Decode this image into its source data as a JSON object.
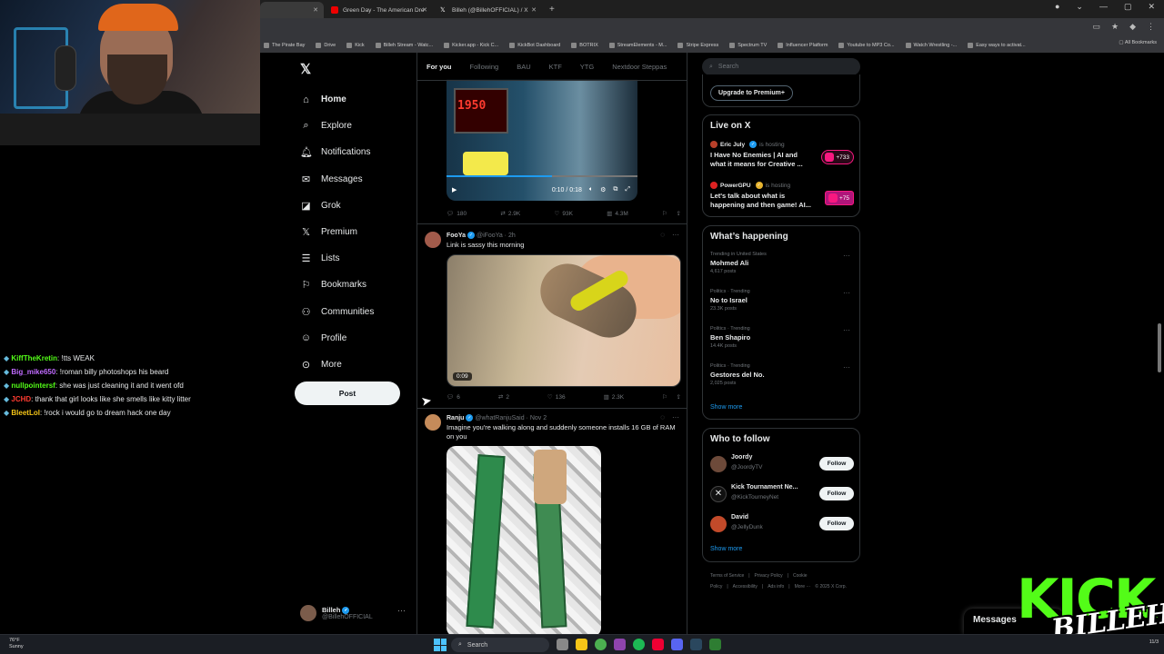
{
  "browser": {
    "tabs": [
      {
        "title": "",
        "active": true
      },
      {
        "title": "Green Day - The American Dre"
      },
      {
        "title": "Billeh (@BillehOFFICIAL) / X"
      }
    ],
    "bookmarks": [
      "The Pirate Bay",
      "Drive",
      "Kick",
      "Billeh Stream - Watc...",
      "Kicker.app - Kick C...",
      "KickBot Dashboard",
      "BOTRIX",
      "StreamElements - M...",
      "Stripe Express",
      "Spectrum TV",
      "Influencer Platform",
      "Youtube to MP3 Co...",
      "Watch Wrestling -...",
      "Easy ways to activat..."
    ],
    "all_bookmarks": "All Bookmarks"
  },
  "chat": [
    {
      "user": "KiffTheKretin",
      "color": "#53fc18",
      "message": ": !tts WEAK"
    },
    {
      "user": "Big_mike650",
      "color": "#c06bff",
      "message": ": !roman billy photoshops his beard"
    },
    {
      "user": "nullpointersf",
      "color": "#53fc18",
      "message": ": she was just cleaning it and it went ofd"
    },
    {
      "user": "JCHD",
      "color": "#ff3b30",
      "message": ": thank that girl looks like she smells like kitty litter"
    },
    {
      "user": "BleetLol",
      "color": "#f5c518",
      "message": ": !rock i would go to dream hack one day"
    }
  ],
  "nav": {
    "items": [
      {
        "label": "Home",
        "icon": "home-icon",
        "glyph": "⌂"
      },
      {
        "label": "Explore",
        "icon": "search-icon",
        "glyph": "⌕"
      },
      {
        "label": "Notifications",
        "icon": "bell-icon",
        "glyph": "🔔︎"
      },
      {
        "label": "Messages",
        "icon": "envelope-icon",
        "glyph": "✉"
      },
      {
        "label": "Grok",
        "icon": "grok-icon",
        "glyph": "◪"
      },
      {
        "label": "Premium",
        "icon": "x-premium-icon",
        "glyph": "𝕏"
      },
      {
        "label": "Lists",
        "icon": "list-icon",
        "glyph": "☰"
      },
      {
        "label": "Bookmarks",
        "icon": "bookmark-icon",
        "glyph": "⚐"
      },
      {
        "label": "Communities",
        "icon": "communities-icon",
        "glyph": "⚇"
      },
      {
        "label": "Profile",
        "icon": "profile-icon",
        "glyph": "☺"
      },
      {
        "label": "More",
        "icon": "more-icon",
        "glyph": "⊙"
      }
    ],
    "post_button": "Post",
    "account": {
      "name": "Billeh",
      "handle": "@BillehOFFICIAL",
      "more": "···"
    }
  },
  "timeline": {
    "tabs": [
      "For you",
      "Following",
      "BAU",
      "KTF",
      "YTG",
      "Nextdoor Steppas"
    ],
    "video1": {
      "readout": "1950",
      "time": "0:10 / 0:18",
      "progress": 0.55
    },
    "post1_actions": {
      "replies": "180",
      "reposts": "2.9K",
      "likes": "93K",
      "views": "4.3M"
    },
    "post2": {
      "name": "FooYa",
      "handle": "@iFooYa · 2h",
      "text": "Link is sassy this morning",
      "video_time": "0:09",
      "actions": {
        "replies": "6",
        "reposts": "2",
        "likes": "136",
        "views": "2.3K"
      }
    },
    "post3": {
      "name": "Ranju",
      "handle": "@whatRanjuSaid · Nov 2",
      "text": "Imagine you're walking along and suddenly someone installs 16 GB of RAM on you"
    }
  },
  "sidebar": {
    "search_placeholder": "Search",
    "premium_button": "Upgrade to Premium+",
    "live_title": "Live on X",
    "live": [
      {
        "host": "Eric July",
        "hosting": "is hosting",
        "title": "I Have No Enemies | AI and what it means for Creative ...",
        "count": "+733"
      },
      {
        "host": "PowerGPU",
        "hosting": "is hosting",
        "title": "Let's talk about what is happening and then game!  AI...",
        "count": "+75"
      }
    ],
    "happening_title": "What’s happening",
    "trends": [
      {
        "context": "Trending in United States",
        "name": "Mohmed Ali",
        "count": "4,617 posts"
      },
      {
        "context": "Politics · Trending",
        "name": "No to Israel",
        "count": "23.3K posts"
      },
      {
        "context": "Politics · Trending",
        "name": "Ben Shapiro",
        "count": "14.4K posts"
      },
      {
        "context": "Politics · Trending",
        "name": "Gestores del No.",
        "count": "2,025 posts"
      }
    ],
    "show_more": "Show more",
    "wtf_title": "Who to follow",
    "follow_label": "Follow",
    "who_to_follow": [
      {
        "name": "Joordy",
        "handle": "@JoordyTV"
      },
      {
        "name": "Kick Tournament Ne...",
        "handle": "@KickTourneyNet"
      },
      {
        "name": "David",
        "handle": "@JellyDunk"
      }
    ],
    "footer": [
      "Terms of Service",
      "|",
      "Privacy Policy",
      "|",
      "Cookie Policy",
      "|",
      "Accessibility",
      "|",
      "Ads info",
      "|",
      "More ···",
      "© 2025 X Corp."
    ]
  },
  "messages_drawer": "Messages",
  "overlay": {
    "kick": "KICK",
    "brand": "BILLEH"
  },
  "taskbar": {
    "temp": "76°F",
    "weather": "Sunny",
    "search": "Search",
    "clock": "11/3"
  },
  "colors": {
    "accent": "#1d9bf0",
    "kick": "#53fc18",
    "live": "#f91880"
  }
}
